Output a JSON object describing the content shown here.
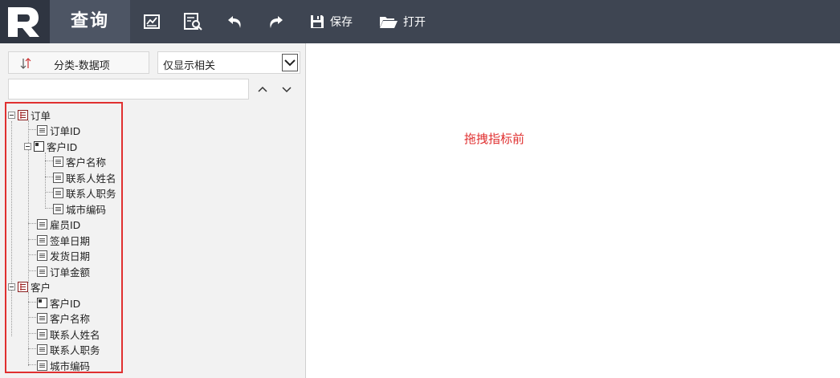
{
  "app": {
    "title": "查询",
    "brand_color": "#3e4552"
  },
  "toolbar": {
    "save_label": "保存",
    "open_label": "打开",
    "icons": [
      "chart-icon",
      "preview-icon",
      "undo-icon",
      "redo-icon",
      "save-icon",
      "folder-open-icon"
    ]
  },
  "sidebar": {
    "sort_label": "分类-数据项",
    "filter_selected": "仅显示相关",
    "search_value": "",
    "tree": [
      {
        "label": "订单",
        "icon": "table-icon"
      },
      {
        "label": "订单ID",
        "icon": "field-icon"
      },
      {
        "label": "客户ID",
        "icon": "key-icon"
      },
      {
        "label": "客户名称",
        "icon": "field-icon"
      },
      {
        "label": "联系人姓名",
        "icon": "field-icon"
      },
      {
        "label": "联系人职务",
        "icon": "field-icon"
      },
      {
        "label": "城市编码",
        "icon": "field-icon"
      },
      {
        "label": "雇员ID",
        "icon": "field-icon"
      },
      {
        "label": "签单日期",
        "icon": "field-icon"
      },
      {
        "label": "发货日期",
        "icon": "field-icon"
      },
      {
        "label": "订单金额",
        "icon": "field-icon"
      },
      {
        "label": "客户",
        "icon": "table-icon"
      },
      {
        "label": "客户ID",
        "icon": "key-icon"
      },
      {
        "label": "客户名称",
        "icon": "field-icon"
      },
      {
        "label": "联系人姓名",
        "icon": "field-icon"
      },
      {
        "label": "联系人职务",
        "icon": "field-icon"
      },
      {
        "label": "城市编码",
        "icon": "field-icon"
      }
    ]
  },
  "main": {
    "hint_text": "拖拽指标前",
    "hint_color": "#e03030"
  }
}
